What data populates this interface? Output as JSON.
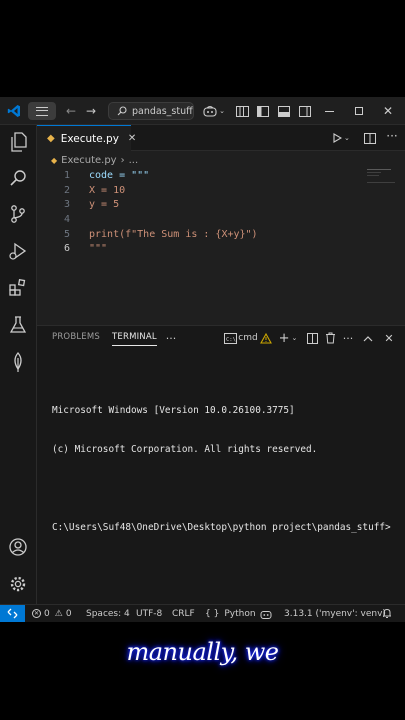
{
  "titlebar": {
    "search_text": "pandas_stuff",
    "colors": {
      "vscode_blue": "#0078d4",
      "background": "#1f1f1f"
    }
  },
  "tab": {
    "label": "Execute.py",
    "icon": "python-file-icon"
  },
  "breadcrumb": {
    "file": "Execute.py",
    "separator": "›",
    "more": "..."
  },
  "code_lines": [
    {
      "num": "1",
      "text": "code = \"\"\""
    },
    {
      "num": "2",
      "text": "X = 10"
    },
    {
      "num": "3",
      "text": "y = 5"
    },
    {
      "num": "4",
      "text": ""
    },
    {
      "num": "5",
      "text": "print(f\"The Sum is : {X+y}\")"
    },
    {
      "num": "6",
      "text": "\"\"\""
    }
  ],
  "panel": {
    "tabs": [
      "PROBLEMS",
      "TERMINAL"
    ],
    "more": "···",
    "terminal_label": "cmd",
    "terminal_lines": [
      "Microsoft Windows [Version 10.0.26100.3775]",
      "(c) Microsoft Corporation. All rights reserved.",
      "",
      "C:\\Users\\Suf48\\OneDrive\\Desktop\\python project\\pandas_stuff>"
    ]
  },
  "statusbar": {
    "errors": "0",
    "warnings": "0",
    "spaces": "Spaces: 4",
    "encoding": "UTF-8",
    "eol": "CRLF",
    "braces": "{ }",
    "language": "Python",
    "interpreter": "3.13.1 ('myenv': venv)"
  },
  "caption": "manually, we"
}
